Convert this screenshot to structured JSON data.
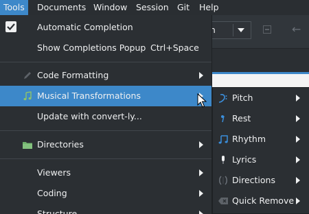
{
  "colors": {
    "highlight": "#3d88c9",
    "menu_bg": "#2b2f33",
    "text": "#eff0f1"
  },
  "menubar": {
    "items": [
      "Tools",
      "Documents",
      "Window",
      "Session",
      "Git",
      "Help"
    ],
    "active": "Tools"
  },
  "toolbar": {
    "combo_value": "dth"
  },
  "tools_menu": {
    "automatic_completion": {
      "label": "Automatic Completion",
      "checked": true
    },
    "show_completions_popup": {
      "label": "Show Completions Popup",
      "shortcut": "Ctrl+Space"
    },
    "code_formatting": {
      "label": "Code Formatting",
      "icon": "pencil-icon"
    },
    "musical_transformations": {
      "label": "Musical Transformations",
      "icon": "music-note-icon",
      "highlighted": true
    },
    "update_convert_ly": {
      "label": "Update with convert-ly..."
    },
    "directories": {
      "label": "Directories",
      "icon": "folder-icon"
    },
    "viewers": {
      "label": "Viewers"
    },
    "coding": {
      "label": "Coding"
    },
    "structure": {
      "label": "Structure"
    }
  },
  "musical_submenu": {
    "items": [
      {
        "label": "Pitch",
        "icon": "pitch-icon"
      },
      {
        "label": "Rest",
        "icon": "rest-icon"
      },
      {
        "label": "Rhythm",
        "icon": "rhythm-icon"
      },
      {
        "label": "Lyrics",
        "icon": "microphone-icon"
      },
      {
        "label": "Directions",
        "icon": "directions-icon"
      },
      {
        "label": "Quick Remove",
        "icon": "quick-remove-icon"
      }
    ]
  }
}
